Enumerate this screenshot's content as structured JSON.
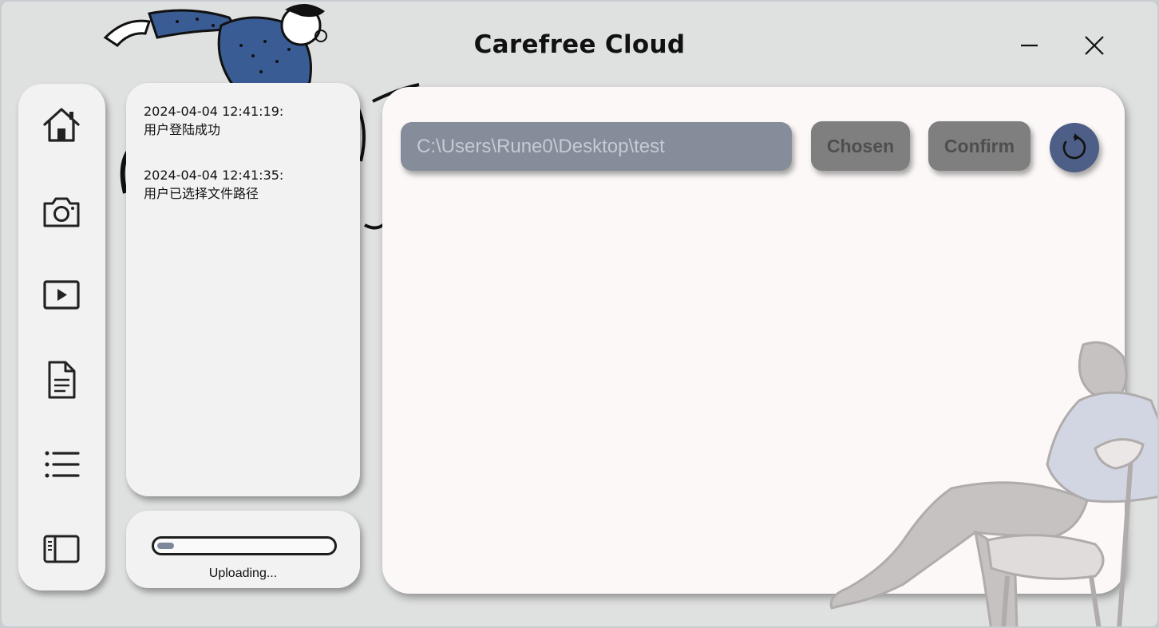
{
  "window": {
    "title": "Carefree Cloud",
    "controls": {
      "minimize_icon": "minimize-icon",
      "close_icon": "close-icon"
    }
  },
  "sidebar": {
    "items": [
      {
        "name": "home",
        "icon": "home-icon"
      },
      {
        "name": "camera",
        "icon": "camera-icon"
      },
      {
        "name": "video",
        "icon": "play-icon"
      },
      {
        "name": "document",
        "icon": "document-icon"
      },
      {
        "name": "list",
        "icon": "list-icon"
      },
      {
        "name": "panel",
        "icon": "sidebar-panel-icon"
      }
    ]
  },
  "log": {
    "entries": [
      {
        "timestamp": "2024-04-04 12:41:19:",
        "message": "用户登陆成功"
      },
      {
        "timestamp": "2024-04-04 12:41:35:",
        "message": "用户已选择文件路径"
      }
    ]
  },
  "upload": {
    "progress": 0.05,
    "status": "Uploading..."
  },
  "main": {
    "path_value": "C:\\Users\\Rune0\\Desktop\\test",
    "chosen_label": "Chosen",
    "confirm_label": "Confirm",
    "refresh_icon": "refresh-icon"
  },
  "colors": {
    "accent": "#4d5f86",
    "progress_fill": "#7c879a",
    "path_bg": "#858d9a",
    "button_bg": "#7f7f7f"
  }
}
